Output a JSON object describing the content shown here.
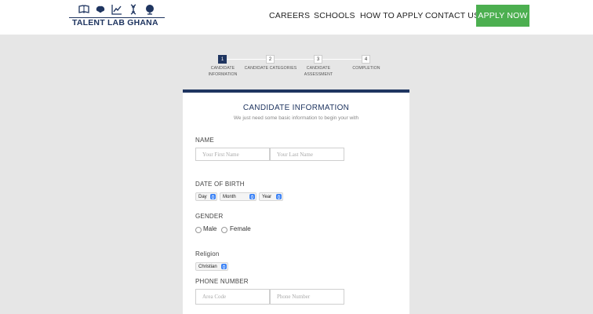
{
  "header": {
    "logo_text": "TALENT LAB GHANA",
    "logo_icons": [
      "book-icon",
      "brain-icon",
      "chart-icon",
      "dna-icon",
      "globe-icon"
    ],
    "nav": [
      "CAREERS",
      "SCHOOLS",
      "HOW TO APPLY",
      "CONTACT US"
    ],
    "apply_label": "APPLY NOW"
  },
  "stepper": {
    "steps": [
      {
        "num": "1",
        "label": "CANDIDATE\nINFORMATION",
        "active": true
      },
      {
        "num": "2",
        "label": "CANDIDATE CATEGORIES",
        "active": false
      },
      {
        "num": "3",
        "label": "CANDIDATE\nASSESSMENT",
        "active": false
      },
      {
        "num": "4",
        "label": "COMPLETION",
        "active": false
      }
    ]
  },
  "form": {
    "title": "CANDIDATE INFORMATION",
    "subtitle": "We just need some basic information to begin your with",
    "name_label": "NAME",
    "first_name_placeholder": "Your First Name",
    "last_name_placeholder": "Your Last Name",
    "dob_label": "DATE OF BIRTH",
    "day_value": "Day",
    "month_value": "Month",
    "year_value": "Year",
    "gender_label": "GENDER",
    "gender_options": [
      "Male",
      "Female"
    ],
    "religion_label": "Religion",
    "religion_value": "Christian",
    "phone_label": "PHONE NUMBER",
    "area_code_placeholder": "Area Code",
    "phone_placeholder": "Phone Number"
  },
  "colors": {
    "brand": "#1f3560",
    "apply": "#4caf50",
    "select_arrow": "#3b82f6",
    "background": "#e6e6e6"
  }
}
